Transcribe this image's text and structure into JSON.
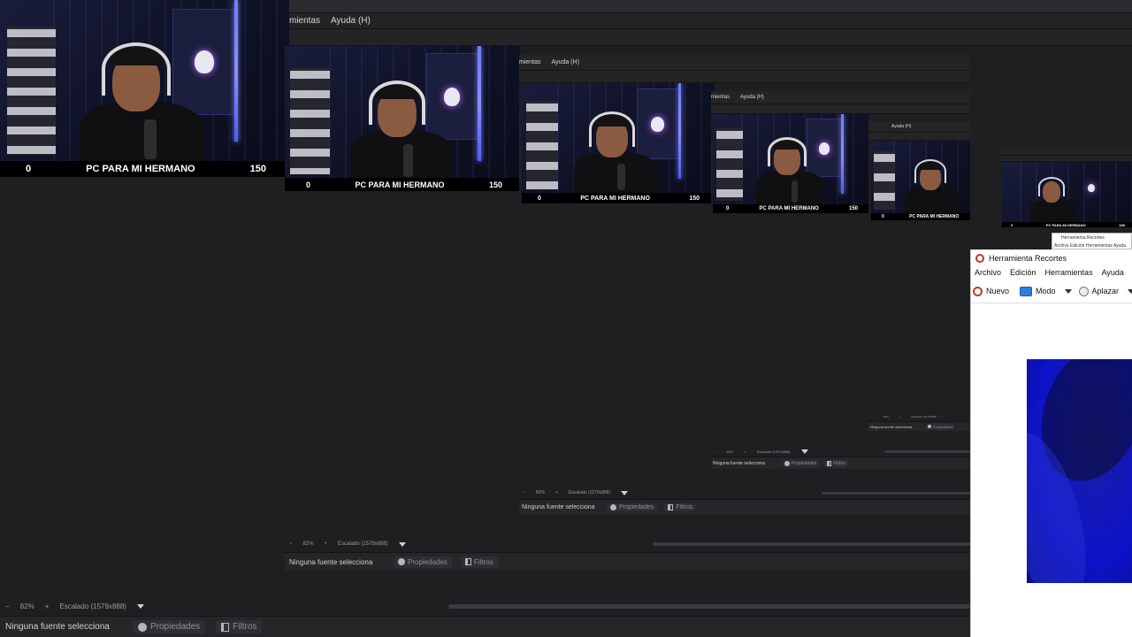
{
  "menu": {
    "tools": "mientas",
    "help": "Ayuda (H)"
  },
  "goal": {
    "current": "0",
    "title": "PC PARA MI HERMANO",
    "target": "150"
  },
  "zoom": {
    "minus": "−",
    "value": "82%",
    "plus": "+",
    "scale": "Escalado (1579x888)"
  },
  "sources": {
    "none": "Ninguna fuente selecciona",
    "properties": "Propiedades",
    "filters": "Filtros"
  },
  "snip": {
    "title": "Herramienta Recortes",
    "menu": [
      "Archivo",
      "Edición",
      "Herramientas",
      "Ayuda"
    ],
    "tools": {
      "new": "Nuevo",
      "mode": "Modo",
      "delay": "Aplazar"
    }
  },
  "mini_snip": {
    "title": "Herramienta Recortes",
    "menu": "Archivo   Edición   Herramientas   Ayuda"
  },
  "colors": {
    "background": "#1c1c1f",
    "goal_bar": "#000000",
    "led": "#7f8bff",
    "capture": "#1218b8"
  }
}
